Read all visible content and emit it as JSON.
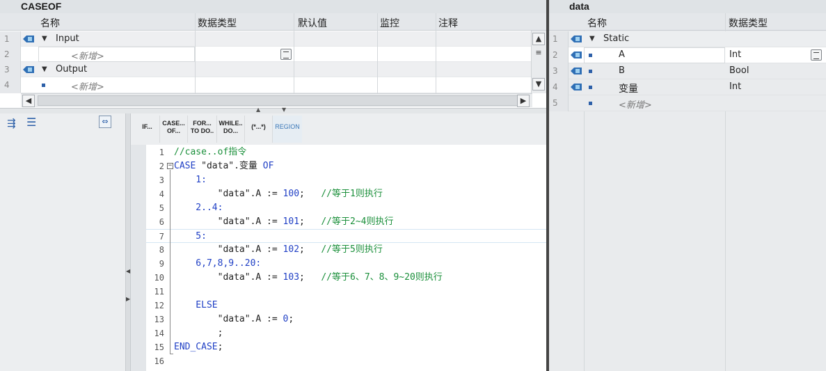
{
  "block": {
    "title": "CASEOF",
    "columns": [
      "名称",
      "数据类型",
      "默认值",
      "监控",
      "注释"
    ],
    "rows": [
      {
        "num": "1",
        "name": "Input",
        "section": true
      },
      {
        "num": "2",
        "name": "<新增>",
        "section": false
      },
      {
        "num": "3",
        "name": "Output",
        "section": true
      },
      {
        "num": "4",
        "name": "<新增>",
        "section": false
      }
    ]
  },
  "toolbar": {
    "buttons": [
      {
        "label": "IF..."
      },
      {
        "label": "CASE...\nOF..."
      },
      {
        "label": "FOR...\nTO DO.."
      },
      {
        "label": "WHILE..\nDO..."
      },
      {
        "label": "(*...*)"
      },
      {
        "label": "REGION"
      }
    ]
  },
  "code_lines": [
    {
      "n": "1",
      "parts": [
        {
          "t": "//case..of指令",
          "c": "cm"
        }
      ]
    },
    {
      "n": "2",
      "parts": [
        {
          "t": "CASE ",
          "c": "kw"
        },
        {
          "t": "\"data\".变量 ",
          "c": "plain"
        },
        {
          "t": "OF",
          "c": "kw"
        }
      ]
    },
    {
      "n": "3",
      "parts": [
        {
          "t": "    1:",
          "c": "num"
        }
      ]
    },
    {
      "n": "4",
      "parts": [
        {
          "t": "        \"data\".A := ",
          "c": "plain"
        },
        {
          "t": "100",
          "c": "num"
        },
        {
          "t": ";   ",
          "c": "plain"
        },
        {
          "t": "//等于1则执行",
          "c": "cm"
        }
      ]
    },
    {
      "n": "5",
      "parts": [
        {
          "t": "    2..4:",
          "c": "num"
        }
      ]
    },
    {
      "n": "6",
      "parts": [
        {
          "t": "        \"data\".A := ",
          "c": "plain"
        },
        {
          "t": "101",
          "c": "num"
        },
        {
          "t": ";   ",
          "c": "plain"
        },
        {
          "t": "//等于2~4则执行",
          "c": "cm"
        }
      ]
    },
    {
      "n": "7",
      "parts": [
        {
          "t": "    5:",
          "c": "num"
        }
      ]
    },
    {
      "n": "8",
      "parts": [
        {
          "t": "        \"data\".A := ",
          "c": "plain"
        },
        {
          "t": "102",
          "c": "num"
        },
        {
          "t": ";   ",
          "c": "plain"
        },
        {
          "t": "//等于5则执行",
          "c": "cm"
        }
      ]
    },
    {
      "n": "9",
      "parts": [
        {
          "t": "    6,7,8,9..20:",
          "c": "num"
        }
      ]
    },
    {
      "n": "10",
      "parts": [
        {
          "t": "        \"data\".A := ",
          "c": "plain"
        },
        {
          "t": "103",
          "c": "num"
        },
        {
          "t": ";   ",
          "c": "plain"
        },
        {
          "t": "//等于6、7、8、9~20则执行",
          "c": "cm"
        }
      ]
    },
    {
      "n": "11",
      "parts": []
    },
    {
      "n": "12",
      "parts": [
        {
          "t": "    ELSE",
          "c": "kw"
        }
      ]
    },
    {
      "n": "13",
      "parts": [
        {
          "t": "        \"data\".A := ",
          "c": "plain"
        },
        {
          "t": "0",
          "c": "num"
        },
        {
          "t": ";",
          "c": "plain"
        }
      ]
    },
    {
      "n": "14",
      "parts": [
        {
          "t": "        ;",
          "c": "plain"
        }
      ]
    },
    {
      "n": "15",
      "parts": [
        {
          "t": "END_CASE",
          "c": "kw"
        },
        {
          "t": ";",
          "c": "plain"
        }
      ]
    },
    {
      "n": "16",
      "parts": []
    }
  ],
  "data_block": {
    "title": "data",
    "columns": [
      "名称",
      "数据类型"
    ],
    "rows": [
      {
        "num": "1",
        "name": "Static",
        "type": "",
        "section": true
      },
      {
        "num": "2",
        "name": "A",
        "type": "Int",
        "section": false
      },
      {
        "num": "3",
        "name": "B",
        "type": "Bool",
        "section": false
      },
      {
        "num": "4",
        "name": "变量",
        "type": "Int",
        "section": false
      },
      {
        "num": "5",
        "name": "<新增>",
        "type": "",
        "section": false
      }
    ]
  },
  "colors": {
    "keyword": "#1f3fc5",
    "comment": "#1a8f3a",
    "header_bg": "#dfe3e6"
  }
}
